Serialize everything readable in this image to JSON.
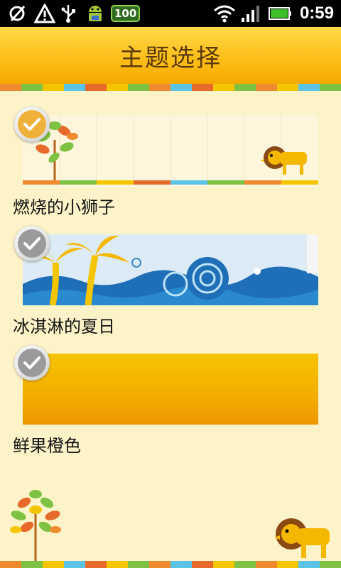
{
  "status_bar": {
    "battery_level": "100",
    "time": "0:59",
    "icons": [
      "sd-card-icon",
      "warning-icon",
      "usb-icon",
      "android-debug-icon",
      "battery-notification-icon",
      "wifi-icon",
      "signal-icon",
      "battery-icon"
    ]
  },
  "header": {
    "title": "主题选择"
  },
  "themes": [
    {
      "name": "燃烧的小狮子",
      "selected": true
    },
    {
      "name": "冰淇淋的夏日",
      "selected": false
    },
    {
      "name": "鲜果橙色",
      "selected": false
    }
  ],
  "colors": {
    "background": "#fdf3c8",
    "header_top": "#ffd84a",
    "header_bottom": "#f5a900",
    "check_selected": "#f0b13a",
    "check_unselected": "#9a9a9a"
  }
}
